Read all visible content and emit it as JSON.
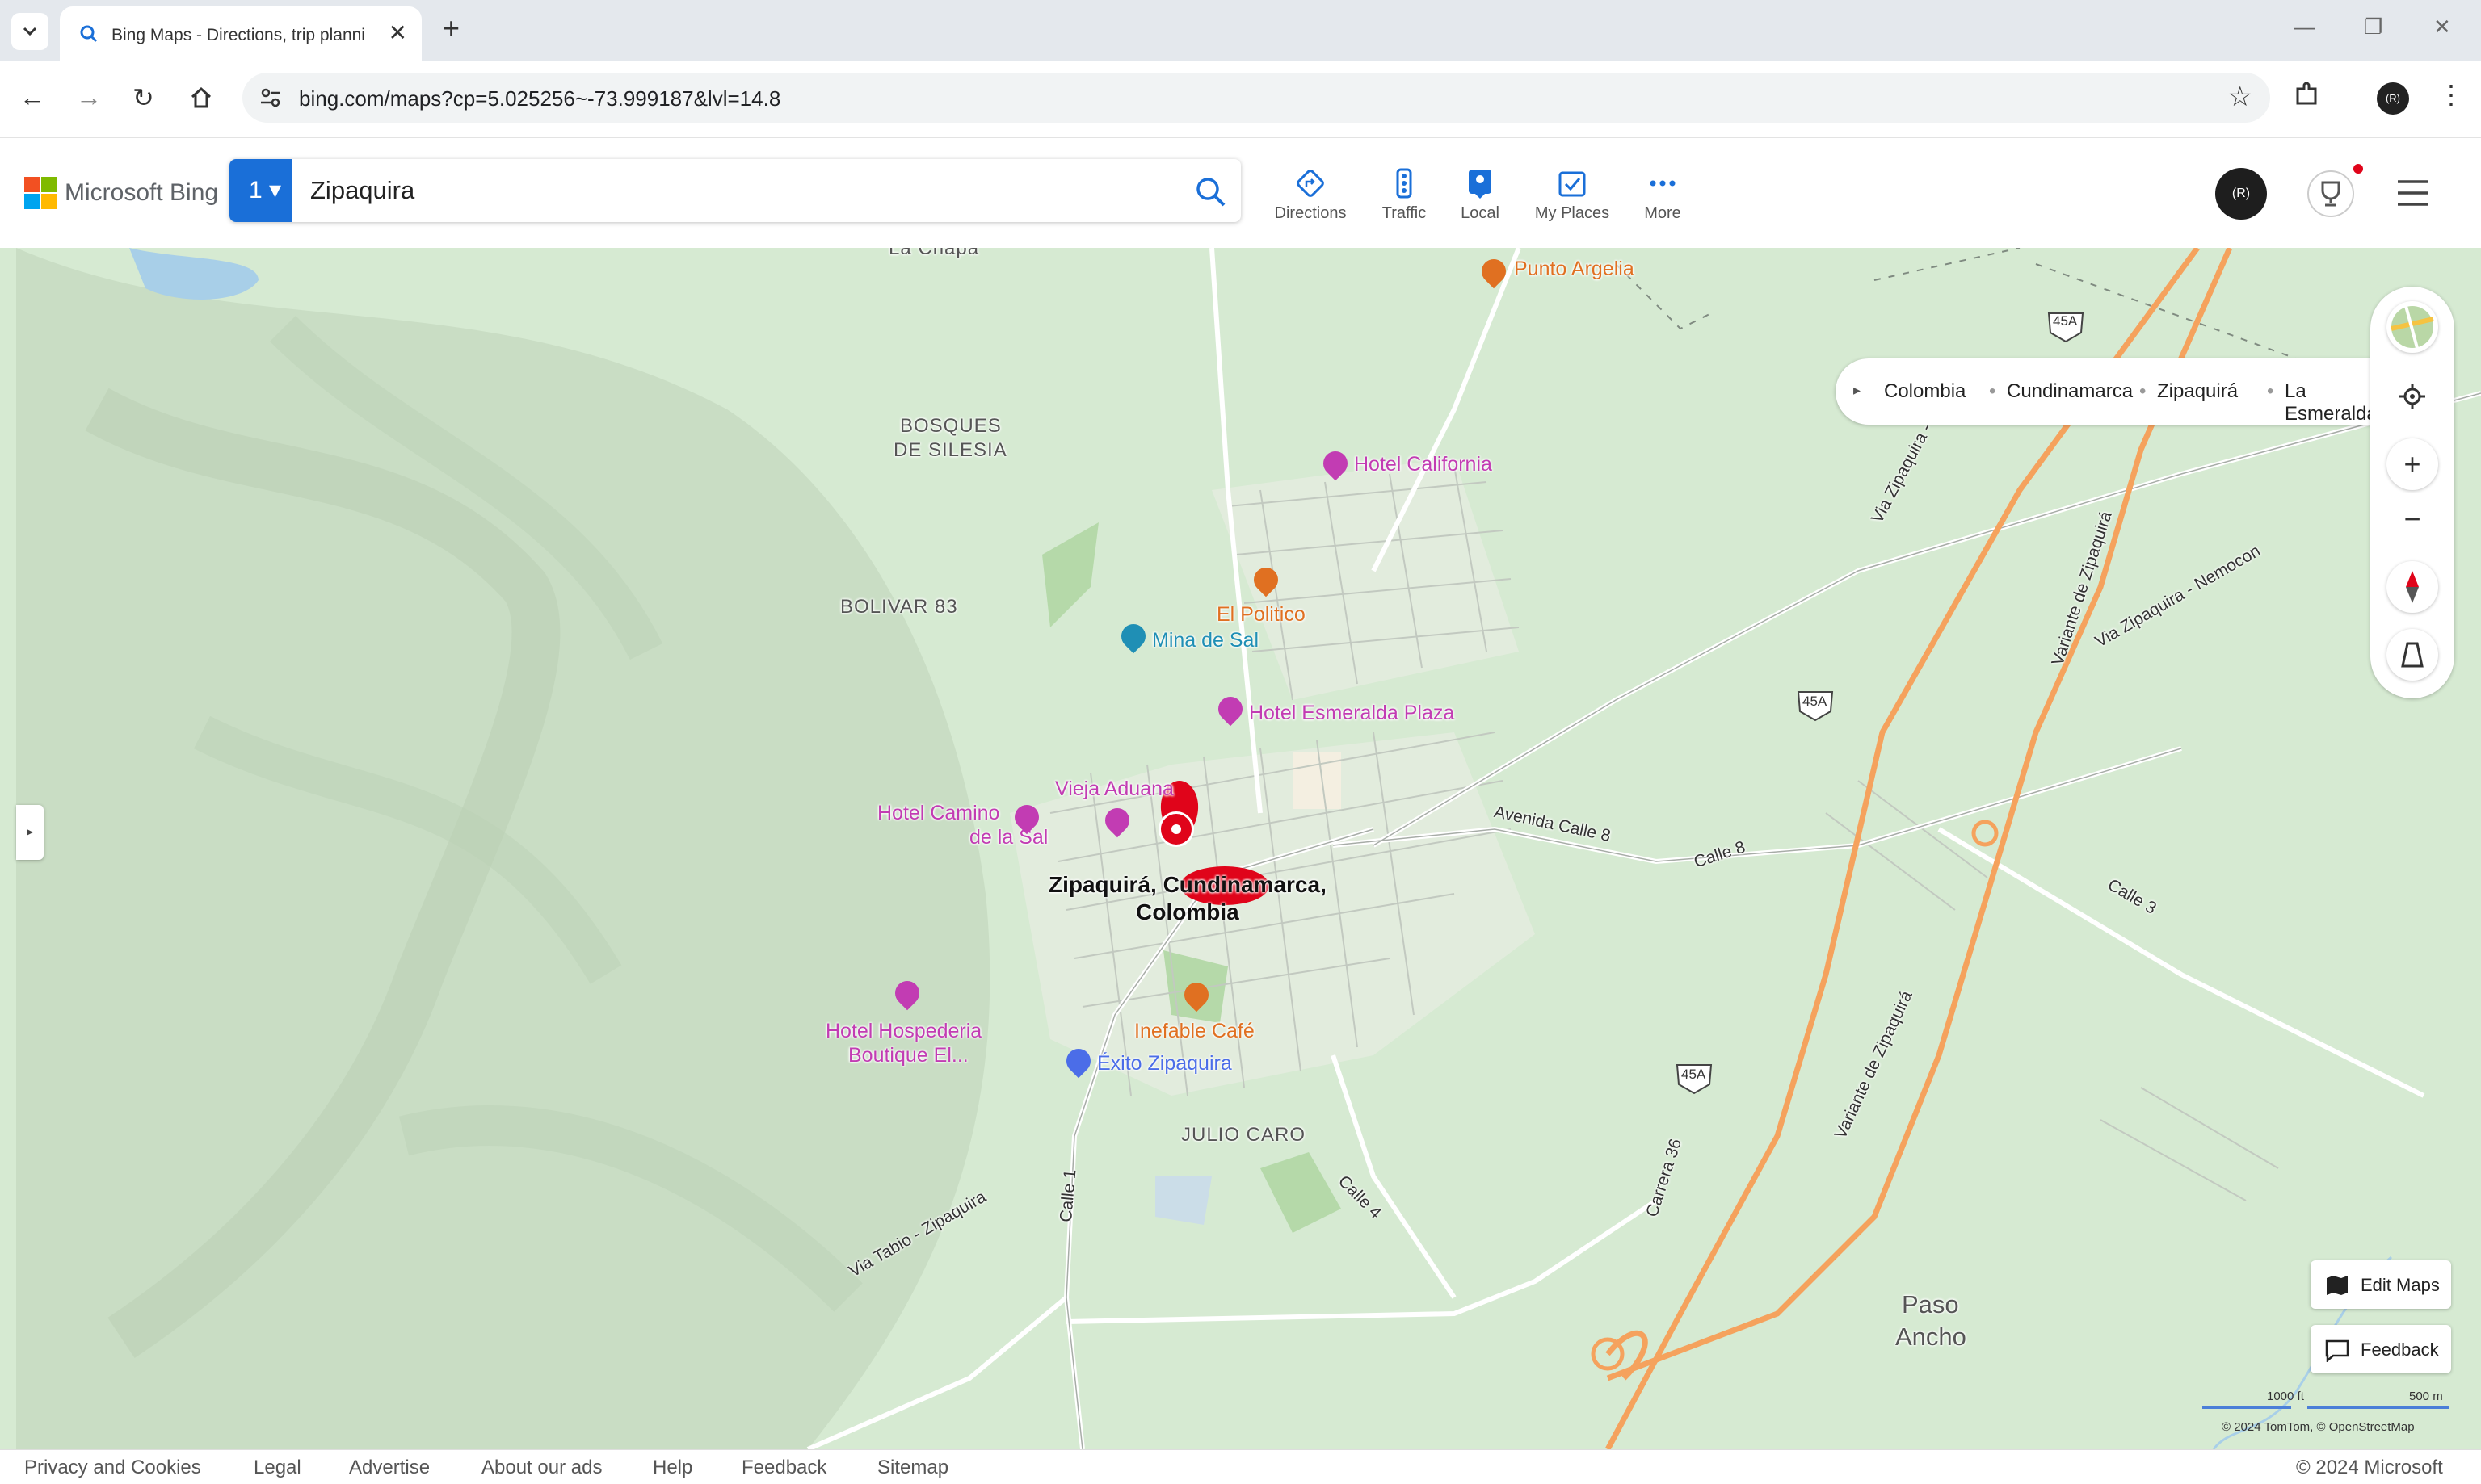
{
  "browser": {
    "tab_title": "Bing Maps - Directions, trip planni",
    "url": "bing.com/maps?cp=5.025256~-73.999187&lvl=14.8",
    "profile_initial": "(R)"
  },
  "header": {
    "logo_text": "Microsoft Bing",
    "search_count": "1",
    "search_value": "Zipaquira",
    "nav": [
      {
        "label": "Directions",
        "icon": "directions-icon"
      },
      {
        "label": "Traffic",
        "icon": "traffic-icon"
      },
      {
        "label": "Local",
        "icon": "local-icon"
      },
      {
        "label": "My Places",
        "icon": "my-places-icon"
      },
      {
        "label": "More",
        "icon": "more-icon"
      }
    ],
    "avatar_initial": "(R)"
  },
  "map": {
    "breadcrumb": [
      "Colombia",
      "Cundinamarca",
      "Zipaquirá",
      "La Esmeralda"
    ],
    "areas": [
      "BOSQUES",
      "DE SILESIA",
      "BOLIVAR 83",
      "JULIO CARO",
      "Paso",
      "Ancho",
      "La Chapa"
    ],
    "pois": {
      "punto_argelia": "Punto Argelia",
      "hotel_california": "Hotel California",
      "el_politico": "El Politico",
      "mina_de_sal": "Mina de Sal",
      "hotel_esmeralda_plaza": "Hotel Esmeralda Plaza",
      "vieja_aduana": "Vieja Aduana",
      "hotel_camino_1": "Hotel Camino",
      "hotel_camino_2": "de la Sal",
      "inefable_cafe": "Inefable Café",
      "exito": "Éxito Zipaquira",
      "hospederia_1": "Hotel Hospederia",
      "hospederia_2": "Boutique El..."
    },
    "pin_label_1": "Zipaquirá, Cundinamarca,",
    "pin_label_2": "Colombia",
    "roads": {
      "avenida_calle_8": "Avenida Calle 8",
      "calle_8": "Calle 8",
      "calle_3": "Calle 3",
      "calle_4": "Calle 4",
      "calle_1": "Calle 1",
      "carrera_36": "Carrera 36",
      "via_tabio": "Via Tabio - Zipaquira",
      "via_ubate": "Via Zipaquira - Ubate",
      "variante_1": "Variante de Zipaquirá",
      "variante_2": "Variante de Zipaquirá",
      "via_nemocon": "Via Zipaquira - Nemocon",
      "shield": "45A"
    },
    "buttons": {
      "edit_maps": "Edit Maps",
      "feedback": "Feedback"
    },
    "scale": {
      "imperial": "1000 ft",
      "metric": "500 m"
    },
    "attribution": "© 2024 TomTom, © OpenStreetMap"
  },
  "footer": {
    "links": [
      "Privacy and Cookies",
      "Legal",
      "Advertise",
      "About our ads",
      "Help",
      "Feedback",
      "Sitemap"
    ],
    "copyright": "© 2024 Microsoft"
  },
  "colors": {
    "accent": "#1a6fd8",
    "pin": "#e0041a",
    "map_bg": "#d6ead2",
    "highway": "#f5a25d"
  }
}
